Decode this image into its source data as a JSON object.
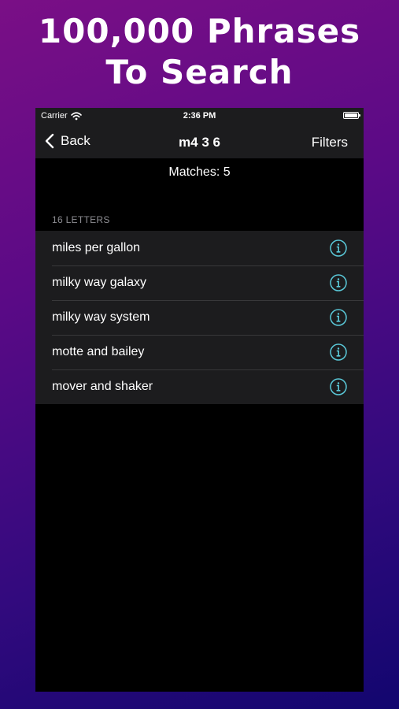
{
  "promo": {
    "headline_line1": "100,000 Phrases",
    "headline_line2": "To Search"
  },
  "status_bar": {
    "carrier": "Carrier",
    "time": "2:36 PM"
  },
  "nav": {
    "back_label": "Back",
    "title": "m4 3 6",
    "filters_label": "Filters"
  },
  "results": {
    "matches_text": "Matches: 5",
    "section_header": "16 LETTERS",
    "items": [
      {
        "label": "miles per gallon"
      },
      {
        "label": "milky way galaxy"
      },
      {
        "label": "milky way system"
      },
      {
        "label": "motte and bailey"
      },
      {
        "label": "mover and shaker"
      }
    ]
  },
  "colors": {
    "accent": "#5ac8d8",
    "background": "#000000",
    "cell": "#1c1c1e",
    "gradient_top": "#7a0f86",
    "gradient_bottom": "#12066f"
  }
}
